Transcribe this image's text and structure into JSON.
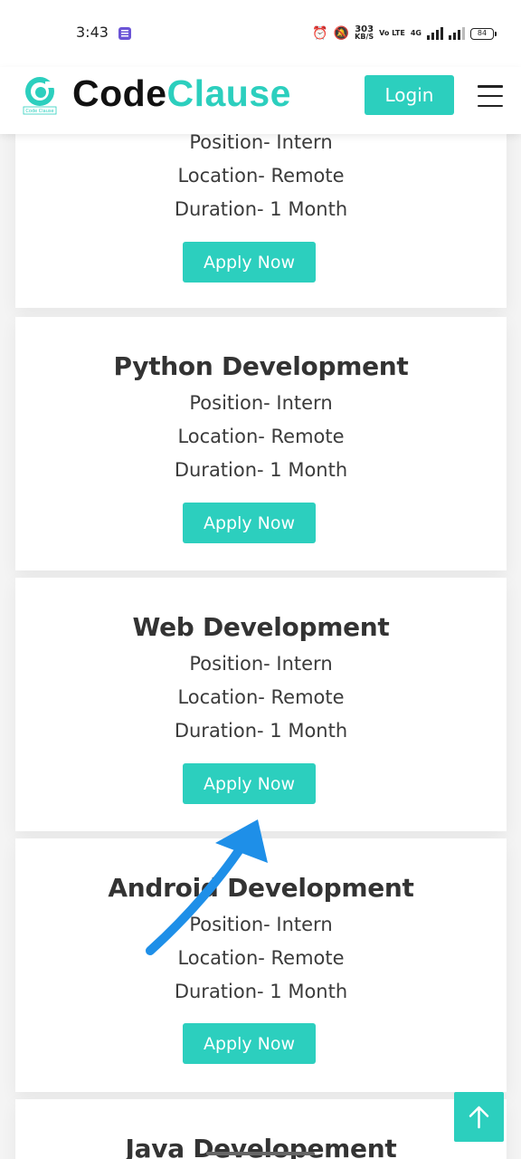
{
  "status_bar": {
    "time": "3:43",
    "speed_value": "303",
    "speed_unit": "KB/S",
    "volte": "Vo LTE",
    "network": "4G",
    "battery": "84",
    "icons": [
      "alarm-icon",
      "mute-icon",
      "signal-icon",
      "battery-icon"
    ]
  },
  "header": {
    "logo_word_1": "Code",
    "logo_word_2": "Clause",
    "logo_tagline": "Code Clause",
    "login_label": "Login",
    "brand_color": "#2ccfbe"
  },
  "cards": [
    {
      "title": "",
      "position": "Position- Intern",
      "location": "Location- Remote",
      "duration": "Duration- 1 Month",
      "button": "Apply Now"
    },
    {
      "title": "Python Development",
      "position": "Position- Intern",
      "location": "Location- Remote",
      "duration": "Duration- 1 Month",
      "button": "Apply Now"
    },
    {
      "title": "Web Development",
      "position": "Position- Intern",
      "location": "Location- Remote",
      "duration": "Duration- 1 Month",
      "button": "Apply Now"
    },
    {
      "title": "Android Development",
      "position": "Position- Intern",
      "location": "Location- Remote",
      "duration": "Duration- 1 Month",
      "button": "Apply Now"
    },
    {
      "title": "Java Developement"
    }
  ],
  "annotation": {
    "color": "#1e8fe8"
  }
}
